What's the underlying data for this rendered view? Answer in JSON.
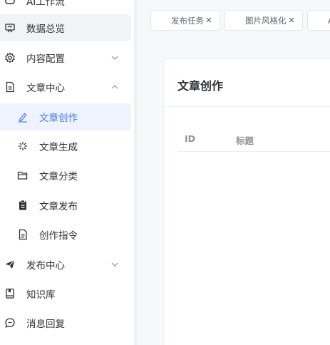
{
  "sidebar": {
    "top_item_label": "AI工作流",
    "items": [
      {
        "label": "数据总览",
        "icon": "dashboard-icon"
      },
      {
        "label": "内容配置",
        "icon": "gear-icon"
      },
      {
        "label": "文章中心",
        "icon": "document-icon"
      },
      {
        "label": "文章创作",
        "icon": "pen-icon"
      },
      {
        "label": "文章生成",
        "icon": "sparkle-icon"
      },
      {
        "label": "文章分类",
        "icon": "folder-icon"
      },
      {
        "label": "文章发布",
        "icon": "clipboard-icon"
      },
      {
        "label": "创作指令",
        "icon": "file-text-icon"
      },
      {
        "label": "发布中心",
        "icon": "send-icon"
      },
      {
        "label": "知识库",
        "icon": "book-icon"
      },
      {
        "label": "消息回复",
        "icon": "chat-icon"
      }
    ]
  },
  "tabs": [
    {
      "label": "发布任务"
    },
    {
      "label": "图片风格化"
    },
    {
      "label": "A"
    }
  ],
  "card": {
    "title": "文章创作",
    "columns": [
      "ID",
      "标题"
    ]
  },
  "colors": {
    "accent": "#4e7cf5",
    "active_bg": "#eef3ff"
  }
}
